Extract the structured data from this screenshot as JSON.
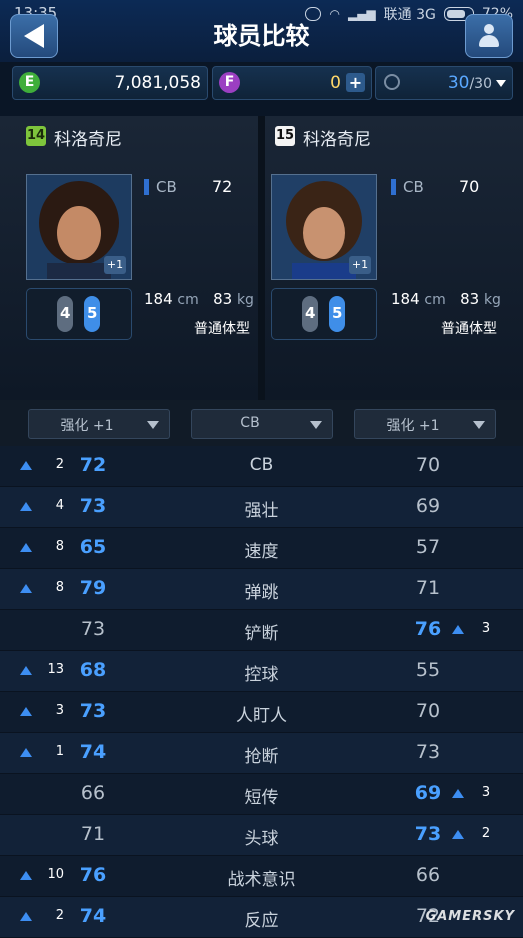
{
  "status_bar": {
    "time": "13:35",
    "carrier": "联通 3G",
    "battery": "72%"
  },
  "header": {
    "title": "球员比较"
  },
  "currency": {
    "e_label": "E",
    "e_value": "7,081,058",
    "f_label": "F",
    "f_value": "0",
    "stamina_current": "30",
    "stamina_max": "/30"
  },
  "players": [
    {
      "number": "14",
      "name": "科洛奇尼",
      "position": "CB",
      "rating": "72",
      "enhance": "+1",
      "weak_foot": "4",
      "strong_foot": "5",
      "height": "184",
      "height_unit": "cm",
      "weight": "83",
      "weight_unit": "kg",
      "body_type": "普通体型",
      "badge_color": "#7ec53c"
    },
    {
      "number": "15",
      "name": "科洛奇尼",
      "position": "CB",
      "rating": "70",
      "enhance": "+1",
      "weak_foot": "4",
      "strong_foot": "5",
      "height": "184",
      "height_unit": "cm",
      "weight": "83",
      "weight_unit": "kg",
      "body_type": "普通体型",
      "badge_color": "#ffffff"
    }
  ],
  "filters": {
    "left": "强化 +1",
    "center": "CB",
    "right": "强化 +1"
  },
  "stats": [
    {
      "name": "CB",
      "left": "72",
      "right": "70",
      "diff": "2",
      "better": "left"
    },
    {
      "name": "强壮",
      "left": "73",
      "right": "69",
      "diff": "4",
      "better": "left"
    },
    {
      "name": "速度",
      "left": "65",
      "right": "57",
      "diff": "8",
      "better": "left"
    },
    {
      "name": "弹跳",
      "left": "79",
      "right": "71",
      "diff": "8",
      "better": "left"
    },
    {
      "name": "铲断",
      "left": "73",
      "right": "76",
      "diff": "3",
      "better": "right"
    },
    {
      "name": "控球",
      "left": "68",
      "right": "55",
      "diff": "13",
      "better": "left"
    },
    {
      "name": "人盯人",
      "left": "73",
      "right": "70",
      "diff": "3",
      "better": "left"
    },
    {
      "name": "抢断",
      "left": "74",
      "right": "73",
      "diff": "1",
      "better": "left"
    },
    {
      "name": "短传",
      "left": "66",
      "right": "69",
      "diff": "3",
      "better": "right"
    },
    {
      "name": "头球",
      "left": "71",
      "right": "73",
      "diff": "2",
      "better": "right"
    },
    {
      "name": "战术意识",
      "left": "76",
      "right": "66",
      "diff": "10",
      "better": "left"
    },
    {
      "name": "反应",
      "left": "74",
      "right": "72",
      "diff": "2",
      "better": "left"
    }
  ],
  "watermark": "GAMERSKY",
  "colors": {
    "accent_blue": "#4aa0ff",
    "e_coin": "#3fae3a",
    "f_coin": "#9b3fc2"
  }
}
